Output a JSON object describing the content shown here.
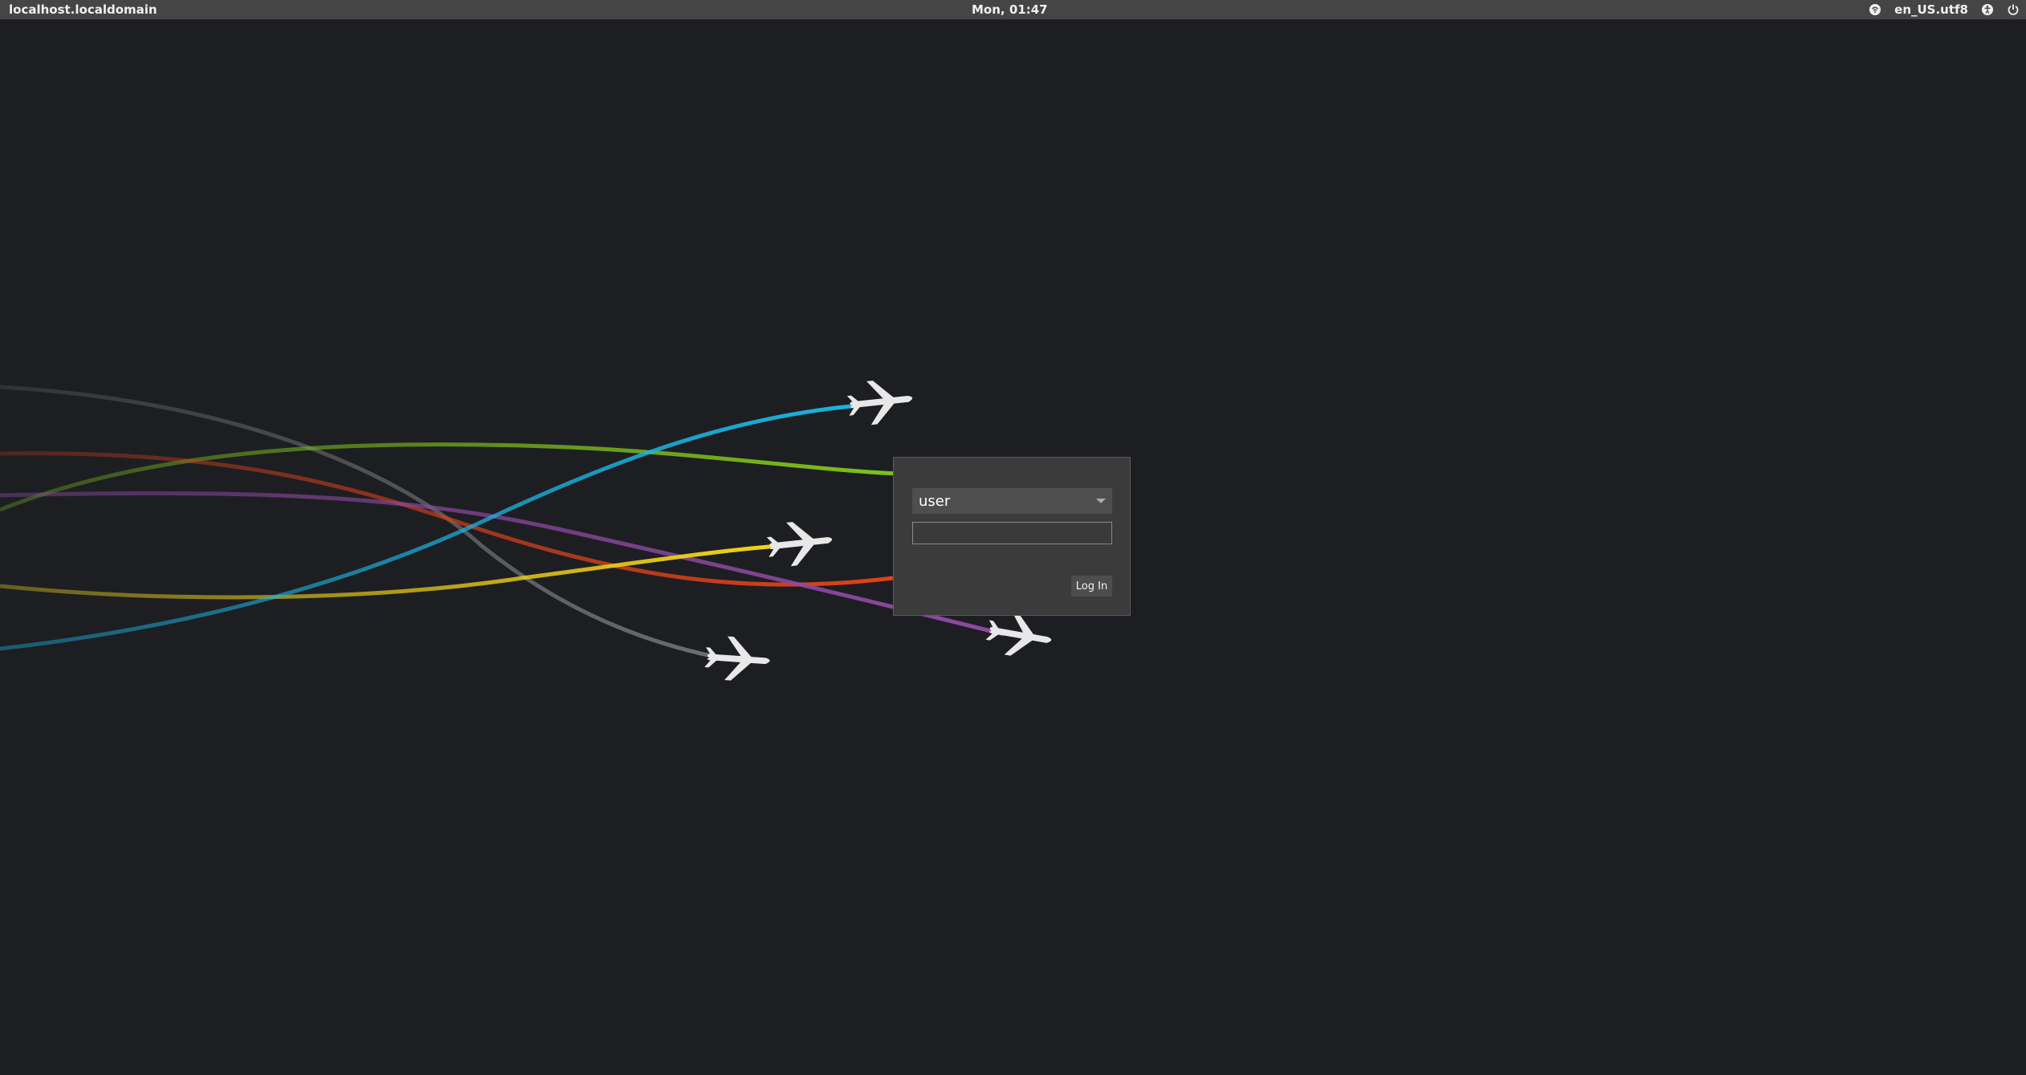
{
  "top_panel": {
    "hostname": "localhost.localdomain",
    "clock": "Mon, 01:47",
    "locale": "en_US.utf8",
    "icons": [
      "network-icon",
      "accessibility-icon",
      "power-icon"
    ]
  },
  "login": {
    "selected_user": "user",
    "password_value": "",
    "login_button_label": "Log In"
  },
  "wallpaper": {
    "trail_colors": {
      "gray": "#6b6e72",
      "green": "#7ec21a",
      "red": "#e1421a",
      "purple": "#8f4aa3",
      "yellow": "#f2d41a",
      "cyan": "#1ab3e0"
    },
    "background": "#1d1e22"
  }
}
